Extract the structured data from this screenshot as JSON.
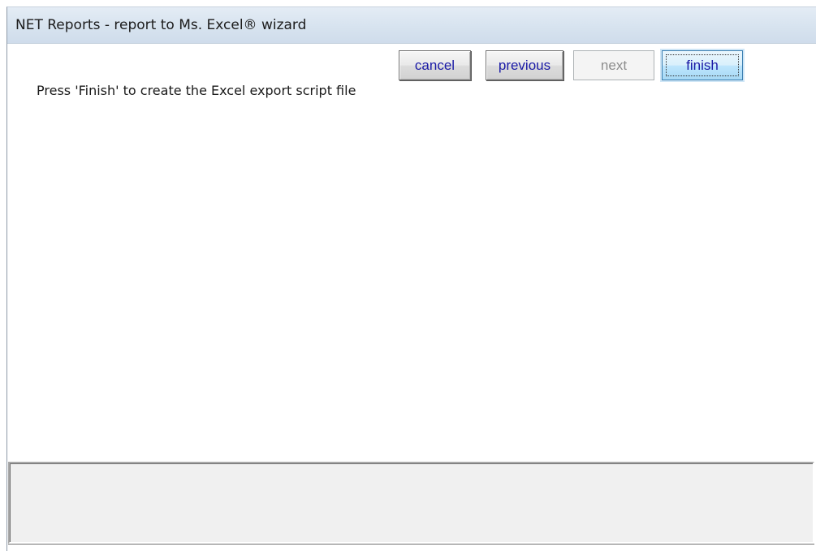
{
  "window": {
    "title": "NET Reports - report to Ms. Excel® wizard"
  },
  "content": {
    "instruction": "Press 'Finish' to create the Excel export script file"
  },
  "buttons": {
    "cancel": "cancel",
    "previous": "previous",
    "next": "next",
    "finish": "finish"
  },
  "button_states": {
    "next_enabled": false,
    "default_button": "finish"
  },
  "colors": {
    "title_bar": "#d7e3ef",
    "button_text": "#1a1aa6",
    "disabled_text": "#8d8d8d",
    "default_button_border": "#3c7fb1"
  }
}
